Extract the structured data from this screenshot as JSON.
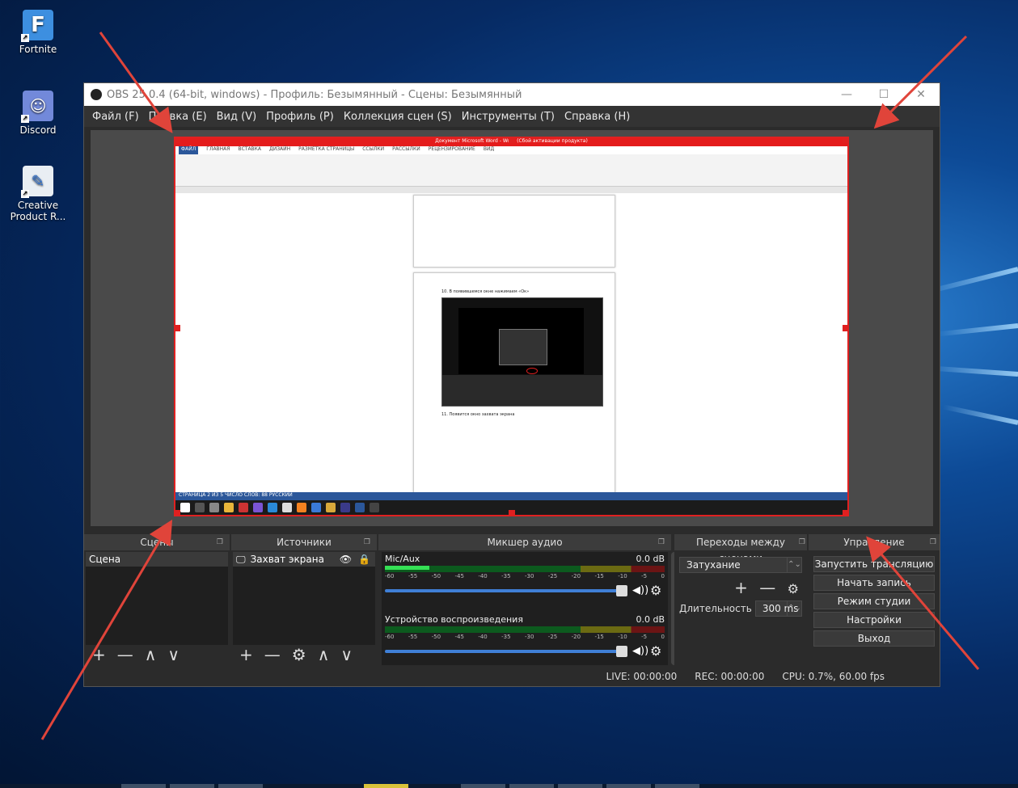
{
  "desktop": {
    "icons": [
      {
        "label": "Fortnite",
        "icon": "fortnite-icon",
        "color": "#3d8fe0"
      },
      {
        "label": "Discord",
        "icon": "discord-icon",
        "color": "#7289da"
      },
      {
        "label": "Creative\nProduct R...",
        "icon": "creative-product-icon",
        "color": "#e9eef3"
      }
    ]
  },
  "window": {
    "title": "OBS 25.0.4 (64-bit, windows) - Профиль: Безымянный - Сцены: Безымянный",
    "minimize": "—",
    "maximize": "☐",
    "close": "✕"
  },
  "menu": [
    "Файл (F)",
    "Правка (E)",
    "Вид (V)",
    "Профиль (P)",
    "Коллекция сцен (S)",
    "Инструменты (T)",
    "Справка (H)"
  ],
  "preview": {
    "word_title": "Документ Microsoft Word - Word (Сбой активации продукта)",
    "word_tabs": [
      "ФАЙЛ",
      "ГЛАВНАЯ",
      "ВСТАВКА",
      "ДИЗАЙН",
      "РАЗМЕТКА СТРАНИЦЫ",
      "ССЫЛКИ",
      "РАССЫЛКИ",
      "РЕЦЕНЗИРОВАНИЕ",
      "ВИД"
    ],
    "doc_line_1": "10. В появившемся окне нажимаем «Ок»",
    "doc_line_2": "11. Появится окно захвата экрана",
    "status_line": "СТРАНИЦА 2 ИЗ 5   ЧИСЛО СЛОВ: 88   РУССКИЙ"
  },
  "docks": {
    "scenes": {
      "title": "Сцены",
      "items": [
        "Сцена"
      ]
    },
    "sources": {
      "title": "Источники",
      "items": [
        "Захват экрана"
      ]
    },
    "mixer": {
      "title": "Микшер аудио",
      "tracks": [
        {
          "name": "Mic/Aux",
          "db": "0.0 dB"
        },
        {
          "name": "Устройство воспроизведения",
          "db": "0.0 dB"
        }
      ],
      "scale": [
        "-60",
        "-55",
        "-50",
        "-45",
        "-40",
        "-35",
        "-30",
        "-25",
        "-20",
        "-15",
        "-10",
        "-5",
        "0"
      ]
    },
    "transitions": {
      "title": "Переходы между сценами",
      "selected": "Затухание",
      "duration_label": "Длительность",
      "duration_value": "300 ms"
    },
    "controls": {
      "title": "Управление",
      "buttons": [
        "Запустить трансляцию",
        "Начать запись",
        "Режим студии",
        "Настройки",
        "Выход"
      ]
    }
  },
  "status": {
    "live": "LIVE: 00:00:00",
    "rec": "REC: 00:00:00",
    "cpu": "CPU: 0.7%, 60.00 fps"
  },
  "colors": {
    "selection": "#e02020",
    "accent": "#3f7fd6",
    "arrows": "#e0443a"
  }
}
